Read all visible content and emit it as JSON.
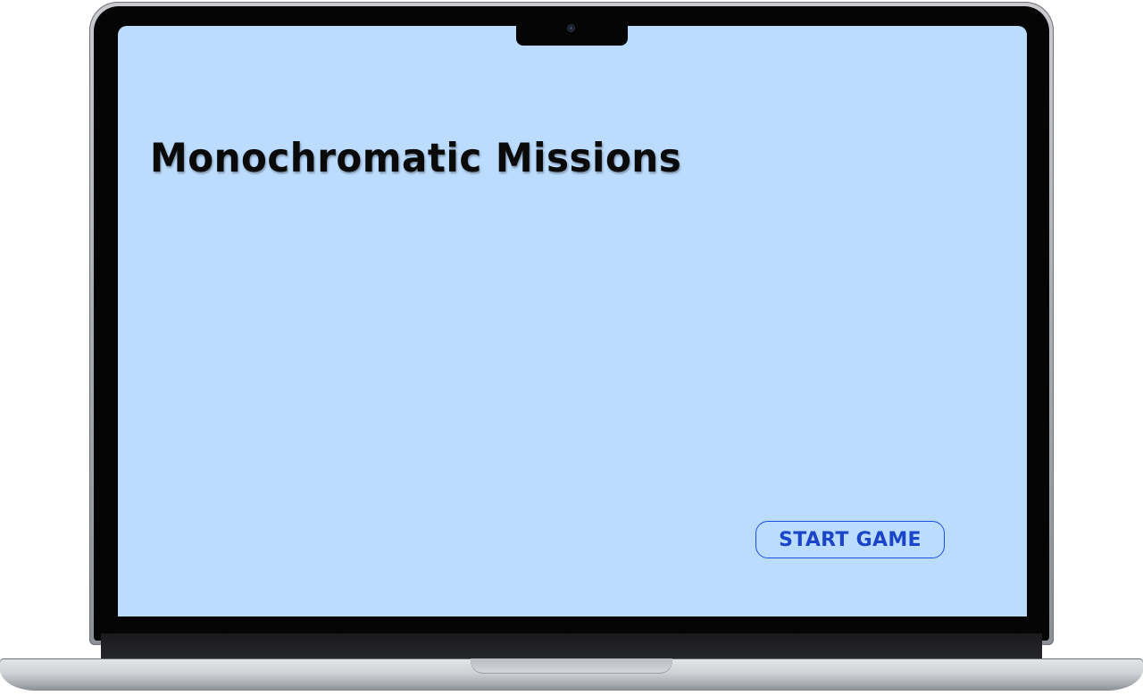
{
  "game": {
    "title": "Monochromatic Missions",
    "start_label": "START GAME"
  },
  "colors": {
    "screen_background": "#bcdcfe",
    "title_text": "#0a0a0a",
    "button_accent": "#1b45c9"
  }
}
